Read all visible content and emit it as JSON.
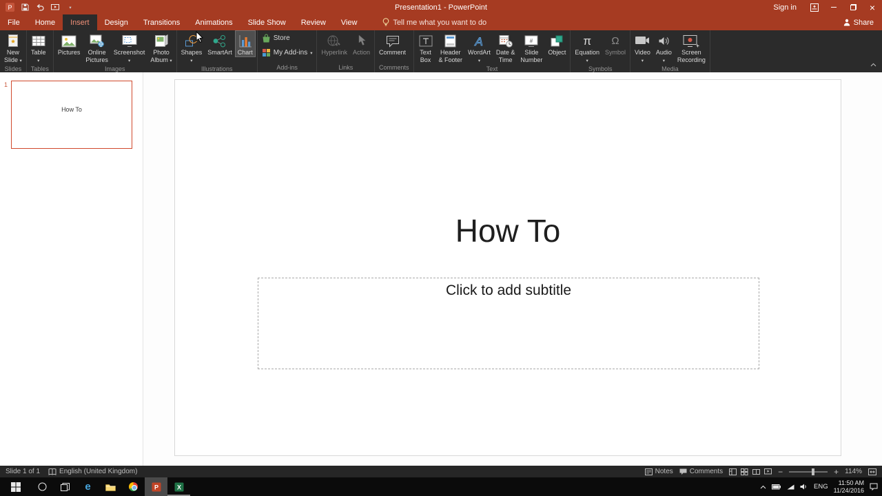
{
  "titlebar": {
    "title": "Presentation1 - PowerPoint",
    "sign_in": "Sign in"
  },
  "tabs": [
    {
      "label": "File"
    },
    {
      "label": "Home"
    },
    {
      "label": "Insert"
    },
    {
      "label": "Design"
    },
    {
      "label": "Transitions"
    },
    {
      "label": "Animations"
    },
    {
      "label": "Slide Show"
    },
    {
      "label": "Review"
    },
    {
      "label": "View"
    }
  ],
  "tellme": {
    "label": "Tell me what you want to do"
  },
  "share": {
    "label": "Share"
  },
  "icons": {
    "chevron_down": "▾",
    "pi": "π",
    "omega": "Ω",
    "close": "×",
    "edge": "e"
  },
  "ribbon": {
    "slides": {
      "label": "Slides",
      "new_slide": {
        "l1": "New",
        "l2": "Slide"
      }
    },
    "tables": {
      "label": "Tables",
      "table": {
        "l1": "Table"
      }
    },
    "images": {
      "label": "Images",
      "pictures": {
        "l1": "Pictures"
      },
      "online_pictures": {
        "l1": "Online",
        "l2": "Pictures"
      },
      "screenshot": {
        "l1": "Screenshot"
      },
      "photo_album": {
        "l1": "Photo",
        "l2": "Album"
      }
    },
    "illustrations": {
      "label": "Illustrations",
      "shapes": {
        "l1": "Shapes"
      },
      "smartart": {
        "l1": "SmartArt"
      },
      "chart": {
        "l1": "Chart"
      }
    },
    "addins": {
      "label": "Add-ins",
      "store": "Store",
      "my_addins": "My Add-ins"
    },
    "links": {
      "label": "Links",
      "hyperlink": {
        "l1": "Hyperlink"
      },
      "action": {
        "l1": "Action"
      }
    },
    "comments": {
      "label": "Comments",
      "comment": {
        "l1": "Comment"
      }
    },
    "text": {
      "label": "Text",
      "text_box": {
        "l1": "Text",
        "l2": "Box"
      },
      "header_footer": {
        "l1": "Header",
        "l2": "& Footer"
      },
      "wordart": {
        "l1": "WordArt"
      },
      "date_time": {
        "l1": "Date &",
        "l2": "Time"
      },
      "slide_number": {
        "l1": "Slide",
        "l2": "Number"
      },
      "object": {
        "l1": "Object"
      }
    },
    "symbols": {
      "label": "Symbols",
      "equation": {
        "l1": "Equation"
      },
      "symbol": {
        "l1": "Symbol"
      }
    },
    "media": {
      "label": "Media",
      "video": {
        "l1": "Video"
      },
      "audio": {
        "l1": "Audio"
      },
      "screen_recording": {
        "l1": "Screen",
        "l2": "Recording"
      }
    }
  },
  "slide_panel": {
    "slide_number": "1",
    "thumbnail_title": "How To"
  },
  "slide": {
    "title": "How To",
    "subtitle_placeholder": "Click to add subtitle"
  },
  "statusbar": {
    "slide_info": "Slide 1 of 1",
    "language": "English (United Kingdom)",
    "notes": "Notes",
    "comments": "Comments",
    "zoom": "114%"
  },
  "taskbar": {
    "lang": "ENG",
    "time": "11:50 AM",
    "date": "11/24/2016"
  },
  "colors": {
    "titlebar_red": "#A63B22",
    "ribbon_bg": "#2B2B2B",
    "accent": "#B7472A",
    "thumb_selected_border": "#D0482B",
    "statusbar_bg": "#262626",
    "taskbar_bg": "#0B0B0B"
  }
}
